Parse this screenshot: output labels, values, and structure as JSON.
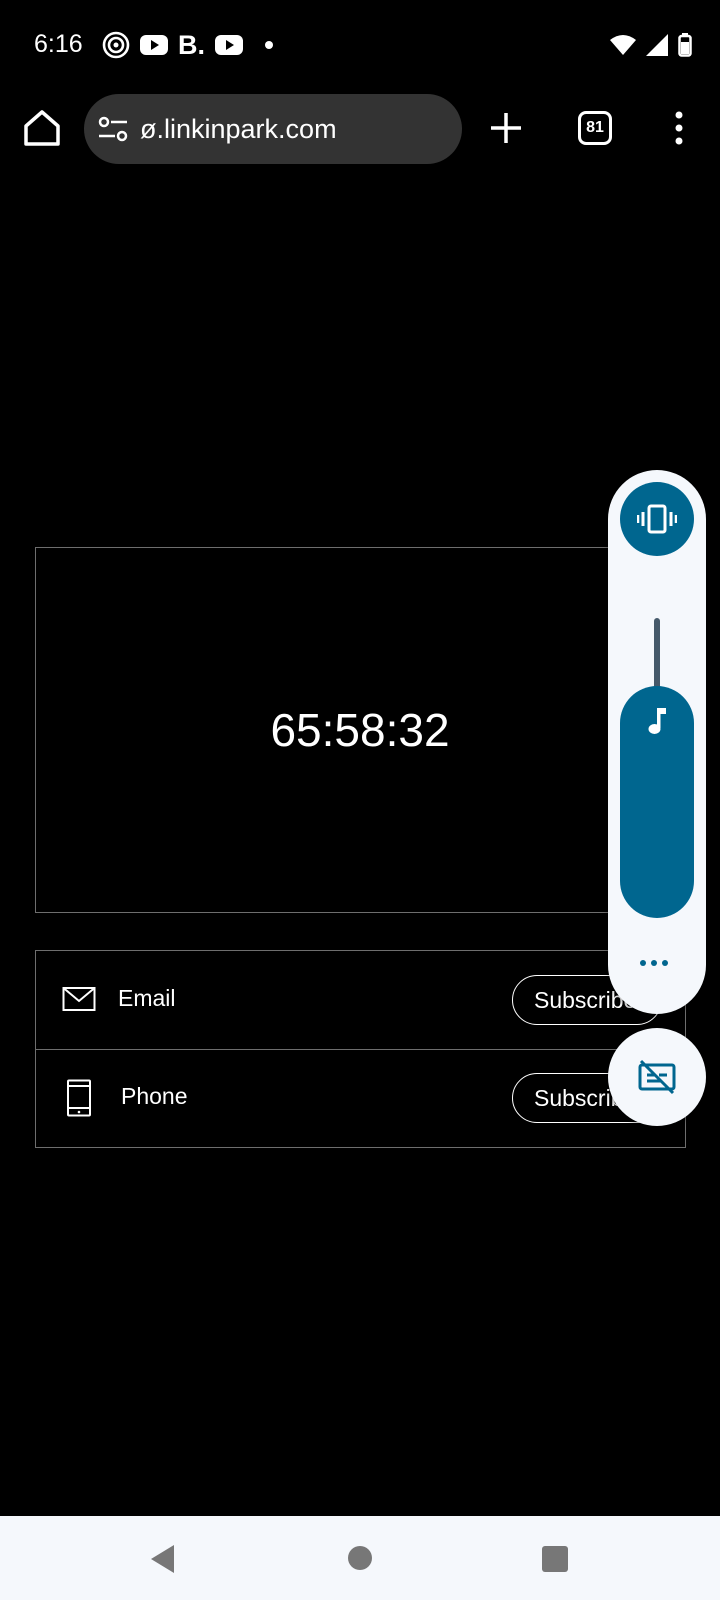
{
  "status_bar": {
    "time": "6:16",
    "left_icons": [
      "threads-icon",
      "youtube-icon",
      "brand-b-icon",
      "youtube-icon",
      "notification-dot"
    ],
    "brand_letter": "B.",
    "right_icons": [
      "wifi-icon",
      "signal-icon",
      "battery-icon"
    ]
  },
  "browser": {
    "url": "ø.linkinpark.com",
    "tab_count": "81",
    "icons": [
      "home-icon",
      "site-settings-icon",
      "new-tab-icon",
      "tab-switcher-icon",
      "more-vert-icon"
    ]
  },
  "content": {
    "countdown": "65:58:32",
    "subscribe_rows": [
      {
        "label": "Email",
        "button": "Subscribe",
        "icon": "mail-icon"
      },
      {
        "label": "Phone",
        "button": "Subscribe",
        "icon": "phone-icon"
      }
    ]
  },
  "volume_panel": {
    "level_fraction": 0.75,
    "accent_color": "#00668f",
    "background_color": "#f5f8fc",
    "icons": [
      "vibrate-icon",
      "music-note-icon",
      "more-horiz-icon",
      "captions-off-icon"
    ]
  },
  "nav_bar": {
    "icons": [
      "back-icon",
      "home-circle-icon",
      "recents-icon"
    ]
  }
}
